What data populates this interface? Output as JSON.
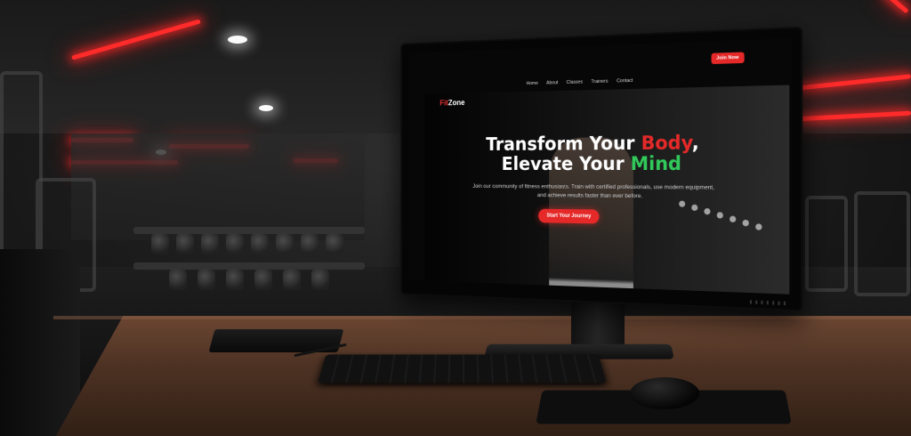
{
  "site": {
    "logo": {
      "prefix": "Fit",
      "suffix": "Zone"
    },
    "nav": {
      "items": [
        "Home",
        "About",
        "Classes",
        "Trainers",
        "Contact"
      ],
      "join_label": "Join Now"
    },
    "hero": {
      "title_line1_a": "Transform Your ",
      "title_line1_b": "Body",
      "title_line1_c": ",",
      "title_line2_a": "Elevate Your ",
      "title_line2_b": "Mind",
      "subtitle_line1": "Join our community of fitness enthusiasts. Train with certified professionals, use modern equipment,",
      "subtitle_line2": "and achieve results faster than ever before.",
      "cta_label": "Start Your Journey"
    }
  },
  "colors": {
    "accent_red": "#e52929",
    "accent_green": "#31c95a",
    "background": "#070707"
  }
}
